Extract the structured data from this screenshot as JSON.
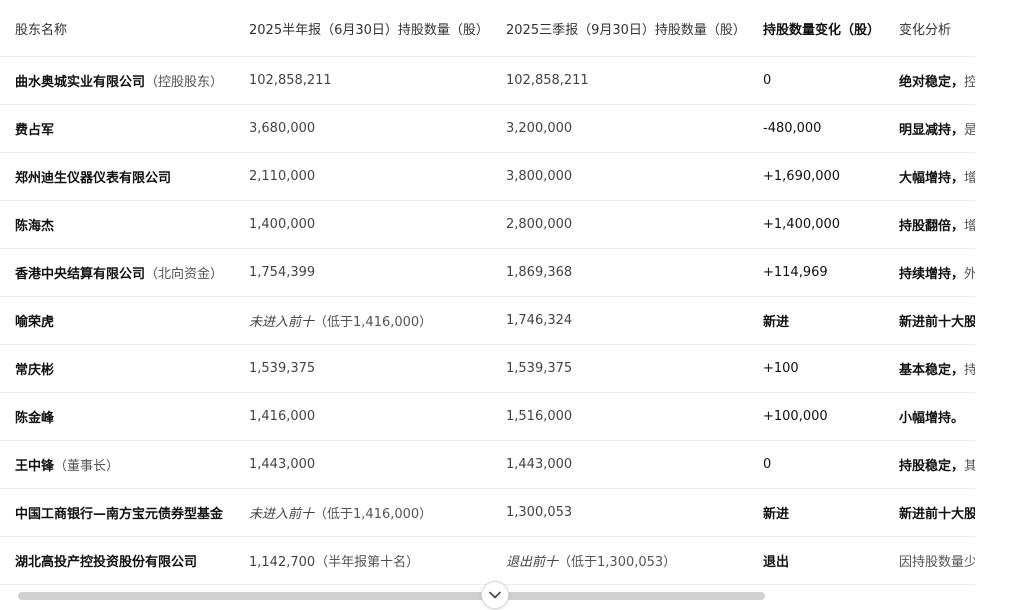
{
  "table": {
    "headers": [
      "股东名称",
      "2025半年报（6月30日）持股数量（股）",
      "2025三季报（9月30日）持股数量（股）",
      "持股数量变化（股）",
      "变化分析"
    ],
    "rows": [
      {
        "name": "曲水奥城实业有限公司",
        "name_note": "（控股股东）",
        "h1": "102,858,211",
        "h1_italic": "",
        "h1_note": "",
        "q3": "102,858,211",
        "q3_italic": "",
        "q3_note": "",
        "change": "0",
        "analysis_bold": "绝对稳定，",
        "analysis_rest": "控"
      },
      {
        "name": "费占军",
        "name_note": "",
        "h1": "3,680,000",
        "h1_italic": "",
        "h1_note": "",
        "q3": "3,200,000",
        "q3_italic": "",
        "q3_note": "",
        "change": "-480,000",
        "analysis_bold": "明显减持，",
        "analysis_rest": "是"
      },
      {
        "name": "郑州迪生仪器仪表有限公司",
        "name_note": "",
        "h1": "2,110,000",
        "h1_italic": "",
        "h1_note": "",
        "q3": "3,800,000",
        "q3_italic": "",
        "q3_note": "",
        "change": "+1,690,000",
        "analysis_bold": "大幅增持，",
        "analysis_rest": "增"
      },
      {
        "name": "陈海杰",
        "name_note": "",
        "h1": "1,400,000",
        "h1_italic": "",
        "h1_note": "",
        "q3": "2,800,000",
        "q3_italic": "",
        "q3_note": "",
        "change": "+1,400,000",
        "analysis_bold": "持股翻倍，",
        "analysis_rest": "增"
      },
      {
        "name": "香港中央结算有限公司",
        "name_note": "（北向资金）",
        "h1": "1,754,399",
        "h1_italic": "",
        "h1_note": "",
        "q3": "1,869,368",
        "q3_italic": "",
        "q3_note": "",
        "change": "+114,969",
        "analysis_bold": "持续增持，",
        "analysis_rest": "外"
      },
      {
        "name": "喻荣虎",
        "name_note": "",
        "h1": "",
        "h1_italic": "未进入前十",
        "h1_note": "（低于1,416,000）",
        "q3": "1,746,324",
        "q3_italic": "",
        "q3_note": "",
        "change": "新进",
        "analysis_bold": "新进前十大股",
        "analysis_rest": ""
      },
      {
        "name": "常庆彬",
        "name_note": "",
        "h1": "1,539,375",
        "h1_italic": "",
        "h1_note": "",
        "q3": "1,539,375",
        "q3_italic": "",
        "q3_note": "",
        "change": "+100",
        "analysis_bold": "基本稳定，",
        "analysis_rest": "持"
      },
      {
        "name": "陈金峰",
        "name_note": "",
        "h1": "1,416,000",
        "h1_italic": "",
        "h1_note": "",
        "q3": "1,516,000",
        "q3_italic": "",
        "q3_note": "",
        "change": "+100,000",
        "analysis_bold": "小幅增持。",
        "analysis_rest": ""
      },
      {
        "name": "王中锋",
        "name_note": "（董事长）",
        "h1": "1,443,000",
        "h1_italic": "",
        "h1_note": "",
        "q3": "1,443,000",
        "q3_italic": "",
        "q3_note": "",
        "change": "0",
        "analysis_bold": "持股稳定，",
        "analysis_rest": "其"
      },
      {
        "name": "中国工商银行—南方宝元债券型基金",
        "name_note": "",
        "h1": "",
        "h1_italic": "未进入前十",
        "h1_note": "（低于1,416,000）",
        "q3": "1,300,053",
        "q3_italic": "",
        "q3_note": "",
        "change": "新进",
        "analysis_bold": "新进前十大股",
        "analysis_rest": ""
      },
      {
        "name": "湖北高投产控投资股份有限公司",
        "name_note": "",
        "h1": "1,142,700",
        "h1_italic": "",
        "h1_note": "（半年报第十名）",
        "q3": "",
        "q3_italic": "退出前十",
        "q3_note": "（低于1,300,053）",
        "change": "退出",
        "analysis_bold": "",
        "analysis_rest": "因持股数量少"
      }
    ]
  },
  "bold_change_rows": [
    "新进",
    "退出"
  ],
  "scroll_down_icon": "chevron-down-icon"
}
